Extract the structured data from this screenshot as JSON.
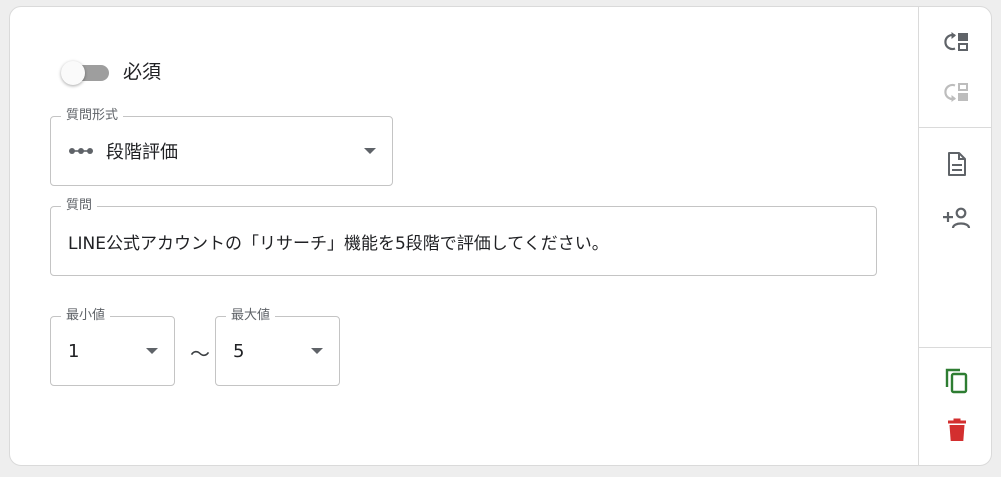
{
  "question_card": {
    "required_label": "必須",
    "required_on": false,
    "format_legend": "質問形式",
    "format_value": "段階評価",
    "question_legend": "質問",
    "question_value": "LINE公式アカウントの「リサーチ」機能を5段階で評価してください。",
    "min_legend": "最小値",
    "min_value": "1",
    "range_separator": "〜",
    "max_legend": "最大値",
    "max_value": "5"
  },
  "side_toolbar": {
    "icons": [
      "move-up-icon",
      "move-down-icon",
      "document-icon",
      "add-person-icon",
      "copy-icon",
      "delete-icon"
    ],
    "colors": {
      "default": "#5f6368",
      "disabled": "#bdbdbd",
      "copy": "#2e7d32",
      "delete": "#d32f2f"
    }
  }
}
